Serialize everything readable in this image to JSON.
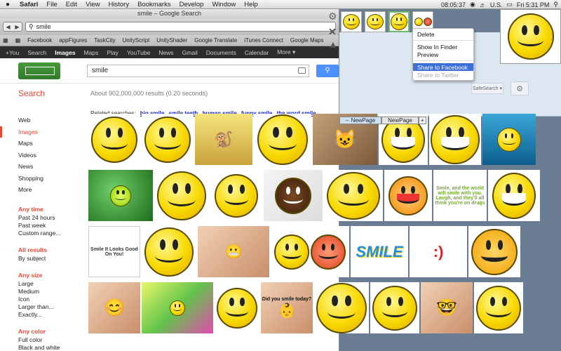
{
  "menubar": {
    "apple": "",
    "items": [
      "Safari",
      "File",
      "Edit",
      "View",
      "History",
      "Bookmarks",
      "Develop",
      "Window",
      "Help"
    ],
    "clock_small": "08:05:37",
    "locale": "U.S.",
    "time": "Fri 5:31 PM"
  },
  "window": {
    "title": "smile – Google Search",
    "address": "smile",
    "bookmarks": [
      "Facebook",
      "appFigures",
      "TaskCity",
      "UnityScript",
      "UnityShader",
      "Google Translate",
      "iTunes Connect",
      "Google Maps"
    ]
  },
  "gbar": [
    "+You",
    "Search",
    "Images",
    "Maps",
    "Play",
    "YouTube",
    "News",
    "Gmail",
    "Documents",
    "Calendar",
    "More ▾"
  ],
  "search": {
    "query": "smile",
    "label": "Search",
    "result_count": "About 902,000,000 results (0.20 seconds)"
  },
  "sidebar": {
    "types": [
      "Web",
      "Images",
      "Maps",
      "Videos",
      "News",
      "Shopping",
      "More"
    ],
    "any_time": {
      "head": "Any time",
      "items": [
        "Past 24 hours",
        "Past week",
        "Custom range..."
      ]
    },
    "all_results": {
      "head": "All results",
      "items": [
        "By subject"
      ]
    },
    "any_size": {
      "head": "Any size",
      "items": [
        "Large",
        "Medium",
        "Icon",
        "Larger than...",
        "Exactly..."
      ]
    },
    "any_color": {
      "head": "Any color",
      "items": [
        "Full color",
        "Black and white"
      ]
    },
    "swatch_colors": [
      "#e33",
      "#f80",
      "#fd0",
      "#3a3"
    ]
  },
  "related": {
    "label": "Related searches:",
    "items": [
      "big smile",
      "smile teeth",
      "human smile",
      "funny smile",
      "the word smile"
    ]
  },
  "right": {
    "safesearch": "SafeSearch ▾",
    "tabs": [
      "NewPage",
      "NewPage"
    ],
    "tab_close": "–",
    "tab_add": "+"
  },
  "context_menu": {
    "items": [
      "Delete",
      "Show In Finder",
      "Preview",
      "Share to Facebook",
      "Share to Twitter"
    ]
  },
  "image_texts": {
    "sunflower": "Smile It Looks Good On You!",
    "quote": "Smile, and the world will smile with you. Laugh, and they'll all think you're on drugs",
    "baby": "Did you smile today?",
    "word": "SMILE"
  }
}
